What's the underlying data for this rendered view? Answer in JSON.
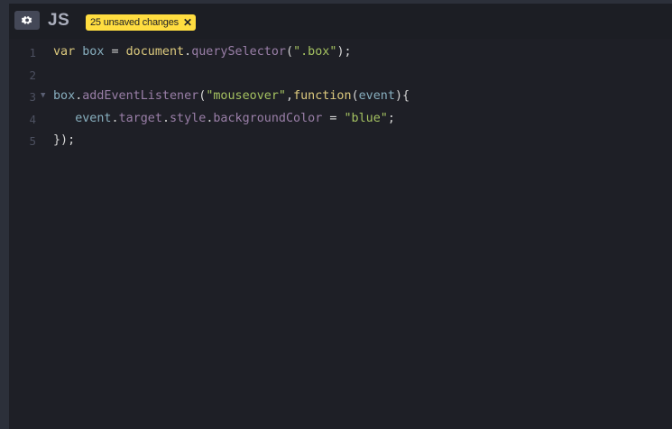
{
  "header": {
    "title": "JS",
    "settings_icon": "gear-icon",
    "unsaved_badge": "25 unsaved changes",
    "badge_close": "✕"
  },
  "colors": {
    "badge_bg": "#ffdd40",
    "editor_bg": "#1e1f26",
    "keyword": "#ddca7e",
    "variable": "#88afbf",
    "property": "#9a7fa8",
    "string": "#a5c261"
  },
  "lines": [
    {
      "number": "1",
      "tokens": [
        "var",
        "box",
        "=",
        "document",
        ".",
        "querySelector",
        "(",
        "\".box\"",
        ");"
      ]
    },
    {
      "number": "2",
      "tokens": []
    },
    {
      "number": "3",
      "tokens": [
        "box",
        ".",
        "addEventListener",
        "(",
        "\"mouseover\"",
        ",",
        "function",
        "(",
        "event",
        "){"
      ]
    },
    {
      "number": "4",
      "tokens": [
        "event",
        ".",
        "target",
        ".",
        "style",
        ".",
        "backgroundColor",
        "=",
        "\"blue\"",
        ";"
      ]
    },
    {
      "number": "5",
      "tokens": [
        "});"
      ]
    }
  ]
}
